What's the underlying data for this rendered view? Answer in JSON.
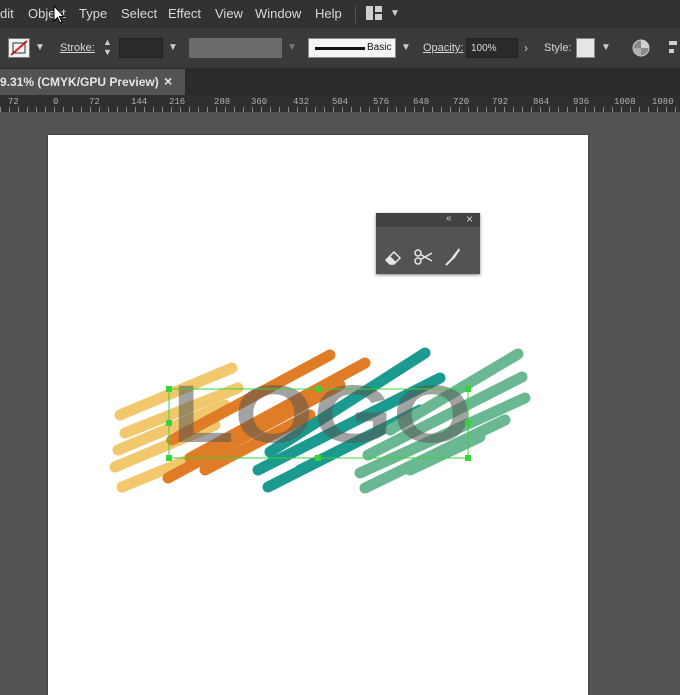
{
  "menu": {
    "items": [
      "dit",
      "Object",
      "Type",
      "Select",
      "Effect",
      "View",
      "Window",
      "Help"
    ]
  },
  "control_bar": {
    "stroke_label": "Stroke:",
    "brush_label": "Basic",
    "opacity_label": "Opacity:",
    "opacity_value": "100%",
    "style_label": "Style:"
  },
  "document_tab": {
    "title": "9.31% (CMYK/GPU Preview)",
    "close_glyph": "×"
  },
  "ruler": {
    "ticks": [
      "72",
      "0",
      "72",
      "144",
      "216",
      "288",
      "360",
      "432",
      "504",
      "576",
      "648",
      "720",
      "792",
      "864",
      "936",
      "1008",
      "1080"
    ]
  },
  "float_panel": {
    "collapse_glyph": "«",
    "close_glyph": "×",
    "tools": [
      "eraser-icon",
      "scissors-icon",
      "knife-icon"
    ]
  },
  "artwork": {
    "text": "LOGO",
    "colors": {
      "yellow": "#f1c86b",
      "orange": "#e07c25",
      "teal": "#1b9a8f",
      "green": "#6ab892",
      "letter": "#6b6b6b",
      "selection": "#3ad43a"
    }
  }
}
